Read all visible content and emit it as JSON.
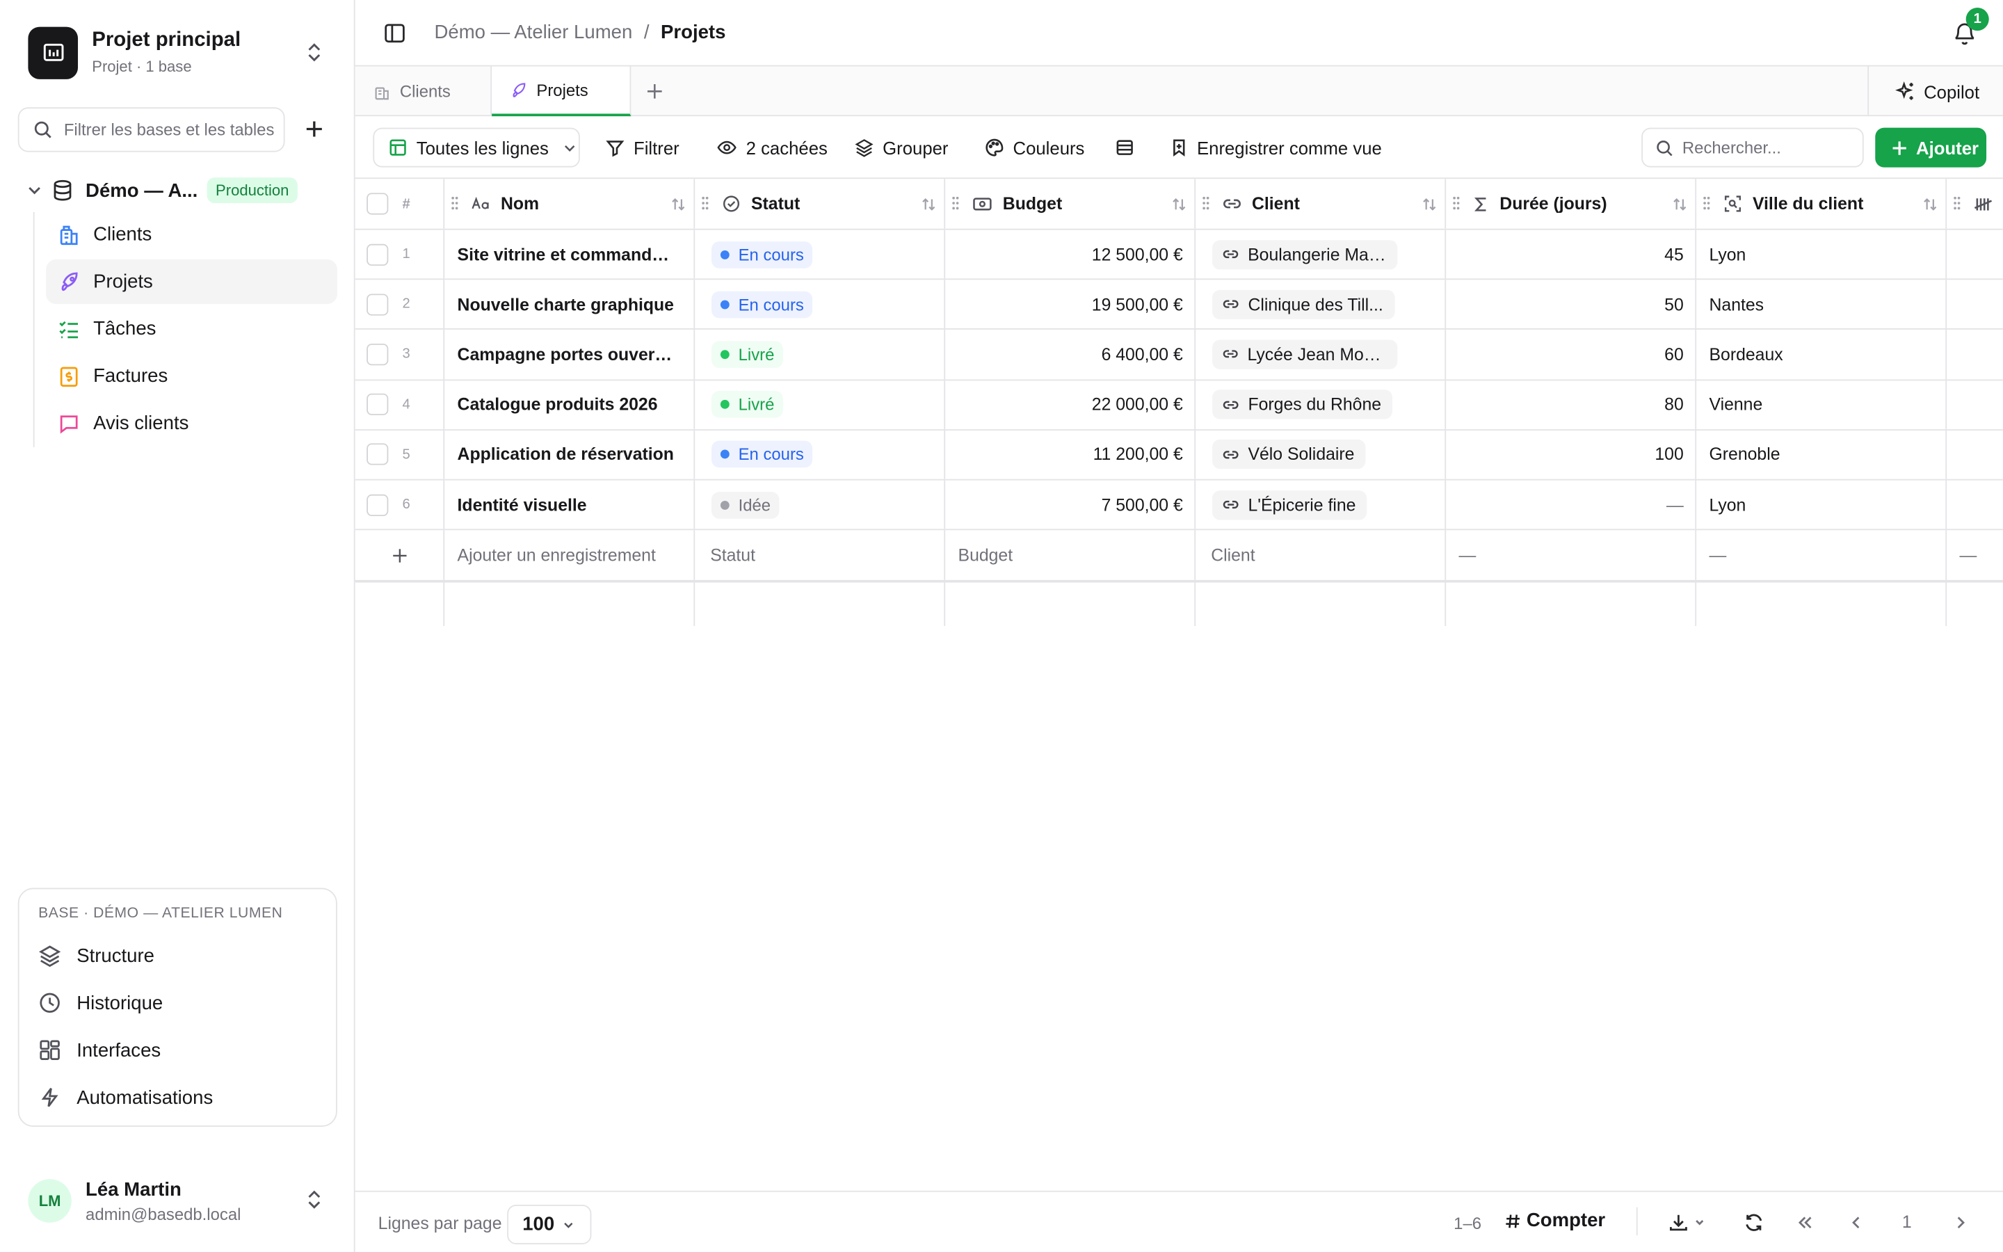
{
  "project": {
    "title": "Projet principal",
    "subtitle": "Projet · 1 base"
  },
  "sidebar": {
    "filter_placeholder": "Filtrer les bases et les tables",
    "base": {
      "name": "Démo — A...",
      "badge": "Production"
    },
    "tables": [
      {
        "label": "Clients",
        "icon": "building-icon",
        "color": "#3b82f6"
      },
      {
        "label": "Projets",
        "icon": "rocket-icon",
        "color": "#8b5cf6",
        "active": true
      },
      {
        "label": "Tâches",
        "icon": "list-checks-icon",
        "color": "#16a34a"
      },
      {
        "label": "Factures",
        "icon": "invoice-icon",
        "color": "#f59e0b"
      },
      {
        "label": "Avis clients",
        "icon": "message-icon",
        "color": "#ec4899"
      }
    ],
    "base_card": {
      "title": "BASE · DÉMO — ATELIER LUMEN",
      "links": [
        {
          "label": "Structure",
          "icon": "layers-icon"
        },
        {
          "label": "Historique",
          "icon": "clock-icon"
        },
        {
          "label": "Interfaces",
          "icon": "layout-icon"
        },
        {
          "label": "Automatisations",
          "icon": "bolt-icon"
        }
      ]
    },
    "user": {
      "initials": "LM",
      "name": "Léa Martin",
      "email": "admin@basedb.local"
    }
  },
  "header": {
    "breadcrumb": [
      "Démo — Atelier Lumen",
      "Projets"
    ],
    "separator": "/",
    "notifications": "1"
  },
  "tabs": [
    {
      "label": "Clients",
      "icon": "building-icon"
    },
    {
      "label": "Projets",
      "icon": "rocket-icon",
      "active": true
    }
  ],
  "copilot_label": "Copilot",
  "toolbar": {
    "view": "Toutes les lignes",
    "filter": "Filtrer",
    "hidden": "2 cachées",
    "group": "Grouper",
    "colors": "Couleurs",
    "save_view": "Enregistrer comme vue",
    "search_placeholder": "Rechercher...",
    "add": "Ajouter"
  },
  "table": {
    "columns": [
      {
        "label": "#"
      },
      {
        "label": "Nom",
        "icon": "text-type-icon"
      },
      {
        "label": "Statut",
        "icon": "status-circle-icon"
      },
      {
        "label": "Budget",
        "icon": "banknote-icon"
      },
      {
        "label": "Client",
        "icon": "link-icon"
      },
      {
        "label": "Durée (jours)",
        "icon": "sigma-icon"
      },
      {
        "label": "Ville du client",
        "icon": "lookup-icon"
      }
    ],
    "rows": [
      {
        "num": "1",
        "nom": "Site vitrine et commande e...",
        "statut": "En cours",
        "statut_color": "#3b82f6",
        "budget": "12 500,00 €",
        "client": "Boulangerie Mar...",
        "duree": "45",
        "ville": "Lyon"
      },
      {
        "num": "2",
        "nom": "Nouvelle charte graphique",
        "statut": "En cours",
        "statut_color": "#3b82f6",
        "budget": "19 500,00 €",
        "client": "Clinique des Till...",
        "duree": "50",
        "ville": "Nantes"
      },
      {
        "num": "3",
        "nom": "Campagne portes ouvertes",
        "statut": "Livré",
        "statut_color": "#22c55e",
        "budget": "6 400,00 €",
        "client": "Lycée Jean Moul...",
        "duree": "60",
        "ville": "Bordeaux"
      },
      {
        "num": "4",
        "nom": "Catalogue produits 2026",
        "statut": "Livré",
        "statut_color": "#22c55e",
        "budget": "22 000,00 €",
        "client": "Forges du Rhône",
        "duree": "80",
        "ville": "Vienne"
      },
      {
        "num": "5",
        "nom": "Application de réservation",
        "statut": "En cours",
        "statut_color": "#3b82f6",
        "budget": "11 200,00 €",
        "client": "Vélo Solidaire",
        "duree": "100",
        "ville": "Grenoble"
      },
      {
        "num": "6",
        "nom": "Identité visuelle",
        "statut": "Idée",
        "statut_color": "#a1a1aa",
        "budget": "7 500,00 €",
        "client": "L'Épicerie fine",
        "duree": "—",
        "ville": "Lyon"
      }
    ],
    "add_row": {
      "nom": "Ajouter un enregistrement",
      "statut": "Statut",
      "budget": "Budget",
      "client": "Client",
      "duree": "—",
      "ville": "—",
      "last": "—"
    }
  },
  "footer": {
    "rows_per_page_label": "Lignes par page",
    "rows_per_page": "100",
    "range": "1–6",
    "count": "Compter",
    "page": "1"
  },
  "colors": {
    "accent": "#16a34a",
    "info": "#3b82f6",
    "muted": "#71717a"
  }
}
